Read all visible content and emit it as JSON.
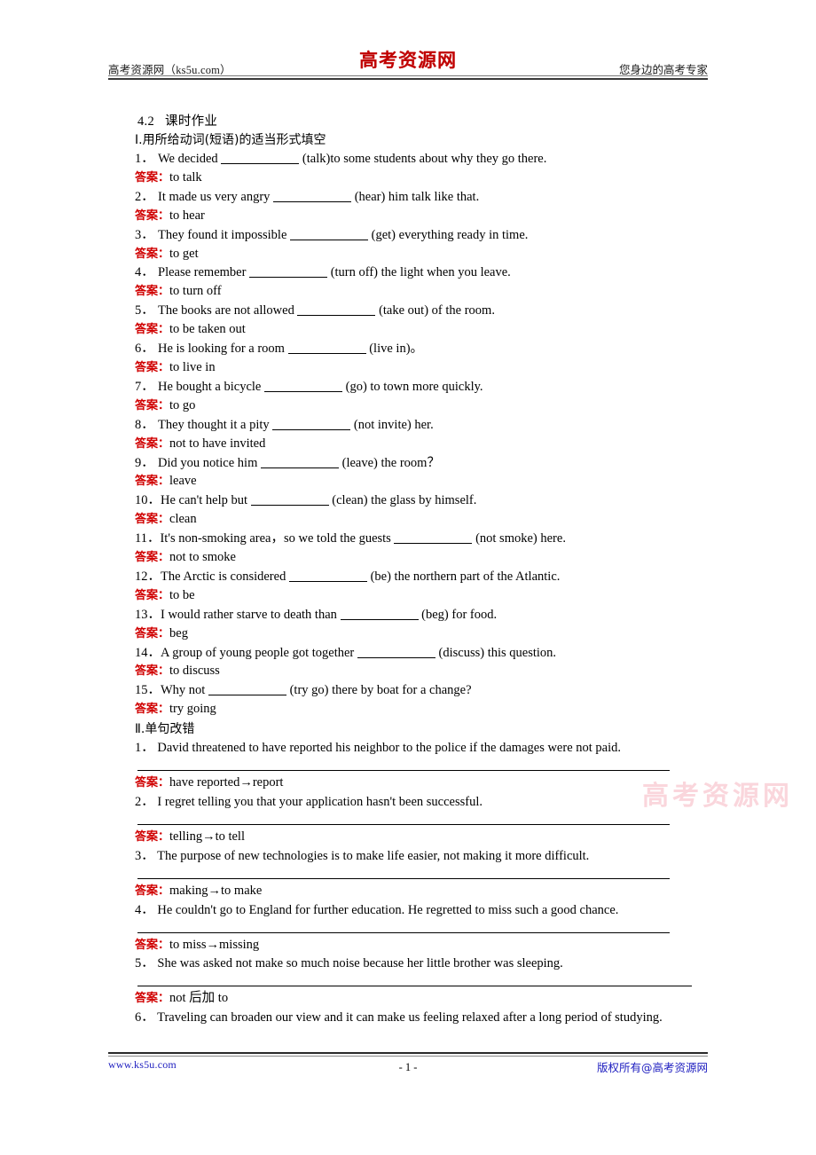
{
  "header": {
    "left_text": "高考资源网（ks5u.com）",
    "logo_text": "高考资源网",
    "right_text": "您身边的高考专家"
  },
  "doc": {
    "title_number": "4.2",
    "title_text": "课时作业"
  },
  "section_one": {
    "heading": "Ⅰ.用所给动词(短语)的适当形式填空",
    "answer_label": "答案：",
    "items": [
      {
        "num": "1．",
        "before": "We decided",
        "after": "(talk)to some students about why    they go there.",
        "answer": "to talk"
      },
      {
        "num": "2．",
        "before": "It made us very angry  ",
        "after": "(hear) him talk like that.",
        "answer": "to hear"
      },
      {
        "num": "3．",
        "before": "They found it impossible",
        "after": "(get) everything ready in time.",
        "answer": "to get"
      },
      {
        "num": "4．",
        "before": "Please remember",
        "after": "(turn off) the light when you leave.",
        "answer": "to turn off"
      },
      {
        "num": "5．",
        "before": "The books are not allowed",
        "after": "(take out) of the room.",
        "answer": "to be taken out"
      },
      {
        "num": "6．",
        "before": "He is looking for a room",
        "after": "(live in)。",
        "answer": "to live in"
      },
      {
        "num": "7．",
        "before": "He bought a bicycle",
        "after": "(go) to town more quickly.",
        "answer": "to go"
      },
      {
        "num": "8．",
        "before": "They thought it a pity",
        "after": "(not invite) her.",
        "answer": "not to have invited"
      },
      {
        "num": "9．",
        "before": "Did you notice him",
        "after": "(leave) the room？",
        "answer": "leave"
      },
      {
        "num": "10．",
        "before": "He can't help but",
        "after": "(clean) the glass by himself.",
        "answer": "clean"
      },
      {
        "num": "11．",
        "before": "It's non-smoking area，so we told the guests",
        "after": "(not smoke) here.",
        "answer": "not to smoke"
      },
      {
        "num": "12．",
        "before": "The Arctic is considered",
        "after": "(be) the northern part of the Atlantic.",
        "answer": "to be"
      },
      {
        "num": "13．",
        "before": "I would rather starve to death than",
        "after": "(beg) for    food.",
        "answer": "beg"
      },
      {
        "num": "14．",
        "before": "A group of young people got together",
        "after": "(discuss) this question.",
        "answer": "to discuss"
      },
      {
        "num": "15．",
        "before": "Why not  ",
        "after": "(try go) there by boat for a change?",
        "answer": "try going"
      }
    ]
  },
  "section_two": {
    "heading": "Ⅱ.单句改错",
    "answer_label": "答案：",
    "items": [
      {
        "num": "1．",
        "sentence": "David threatened to have reported his neighbor to the police if the damages were not paid.",
        "answer": "have reported→report"
      },
      {
        "num": "2．",
        "sentence": "I regret   telling   you   that   your application   hasn't   been successful.",
        "answer": "telling→to tell"
      },
      {
        "num": "3．",
        "sentence": "The purpose of new technologies is to make life easier, not   making it more difficult.",
        "answer": "making→to make"
      },
      {
        "num": "4．",
        "sentence": "He couldn't go to England for further education. He regretted   to miss such a good chance.",
        "answer": "to miss→missing"
      },
      {
        "num": "5．",
        "sentence": "She was asked not make so much noise because her little brother was sleeping.",
        "answer": "not 后加 to"
      },
      {
        "num": "6．",
        "sentence": "Traveling can broaden our view and it can make us feeling relaxed after a long period of studying.",
        "answer": ""
      }
    ]
  },
  "watermark": {
    "text": "高考资源网"
  },
  "footer": {
    "left_text": "www.ks5u.com",
    "page_number": "- 1 -",
    "right_text": "版权所有@高考资源网"
  }
}
